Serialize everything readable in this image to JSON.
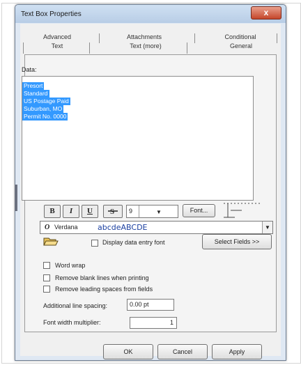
{
  "dialog": {
    "title": "Text Box Properties",
    "close_glyph": "x"
  },
  "tabs": {
    "back_row": [
      "Advanced",
      "Attachments",
      "Conditional"
    ],
    "front_row": [
      "Text",
      "Text (more)",
      "General"
    ],
    "active": "Text"
  },
  "data": {
    "label": "Data:",
    "lines": [
      "Presort",
      "Standard",
      "US Postage Paid",
      "Suburban, MO",
      "Permit No. 0000"
    ]
  },
  "format_toolbar": {
    "bold": "B",
    "italic": "I",
    "underline": "U",
    "strike_icon": "strikethrough-icon",
    "font_size": "9",
    "font_button": "Font...",
    "alignment_icon": "alignment-slider-icon"
  },
  "font_select": {
    "icon": "opentype-font-icon",
    "icon_glyph": "O",
    "name": "Verdana",
    "sample": "abcdeABCDE"
  },
  "row_actions": {
    "open_icon": "open-folder-icon",
    "display_entry_font": "Display data entry font",
    "select_fields": "Select Fields >>"
  },
  "options": {
    "word_wrap": "Word wrap",
    "remove_blank": "Remove blank lines when printing",
    "remove_leading": "Remove leading spaces from fields"
  },
  "spacing": {
    "label": "Additional line spacing:",
    "value": "0.00 pt"
  },
  "width": {
    "label": "Font width multiplier:",
    "value": "1"
  },
  "buttons": {
    "ok": "OK",
    "cancel": "Cancel",
    "apply": "Apply"
  },
  "colors": {
    "selection": "#3399ff",
    "titlebar": "#c4d7ec",
    "close": "#c5462a",
    "sample_text": "#1a3fa0"
  }
}
